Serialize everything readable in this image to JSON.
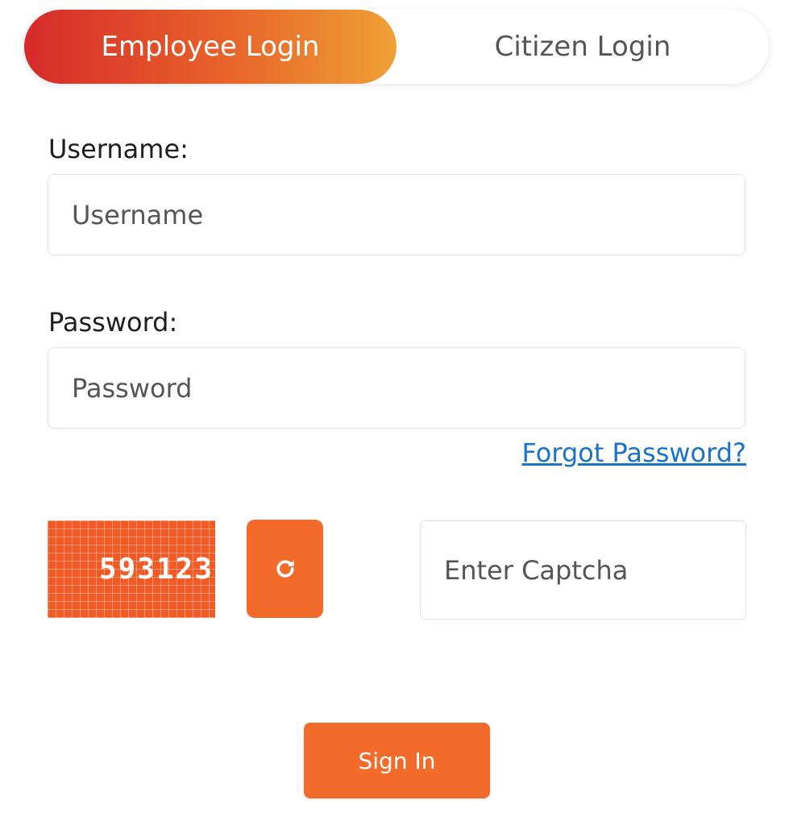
{
  "tabs": {
    "employee_label": "Employee Login",
    "citizen_label": "Citizen Login",
    "active": "employee"
  },
  "form": {
    "username_label": "Username:",
    "username_placeholder": "Username",
    "password_label": "Password:",
    "password_placeholder": "Password",
    "forgot_password": "Forgot Password?",
    "captcha_code": "593123",
    "captcha_placeholder": "Enter Captcha",
    "refresh_icon": "refresh-icon",
    "signin_label": "Sign In"
  },
  "colors": {
    "accent": "#f26b2a",
    "gradient_start": "#d62a2a",
    "gradient_end": "#eea136",
    "link": "#1a73c8"
  }
}
